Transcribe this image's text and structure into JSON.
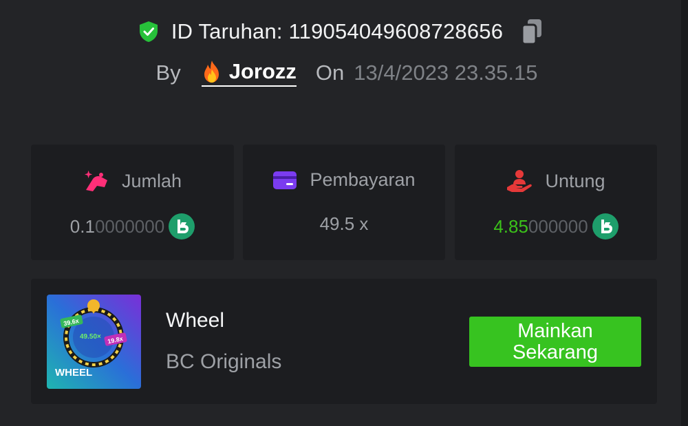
{
  "header": {
    "bet_id_text": "ID Taruhan: 1190540496087286 56",
    "by_label": "By",
    "username": "Jorozz",
    "on_label": "On",
    "date": "13/4/2023 23.35.15"
  },
  "stats": {
    "amount": {
      "label": "Jumlah",
      "value_main": "0.1",
      "value_dim": "0000000",
      "icon": "hand-coins-icon",
      "icon_color": "#ff2f78"
    },
    "payout": {
      "label": "Pembayaran",
      "value": "49.5 x",
      "icon": "card-icon",
      "icon_color": "#7b3cf0"
    },
    "profit": {
      "label": "Untung",
      "value_main": "4.85",
      "value_dim": "000000",
      "icon": "hand-person-icon",
      "icon_color": "#e63939"
    }
  },
  "game": {
    "thumb_title": "WHEEL",
    "thumb_mult_center": "49.50×",
    "thumb_mult_left": "39.6x",
    "thumb_mult_right": "19.8x",
    "name": "Wheel",
    "provider": "BC Originals",
    "play_label": "Mainkan\nSekarang"
  },
  "colors": {
    "background": "#232427",
    "card": "#1c1d20",
    "accent_green": "#37c320",
    "profit_green": "#3bc11a",
    "coin": "#1e9e6b"
  }
}
